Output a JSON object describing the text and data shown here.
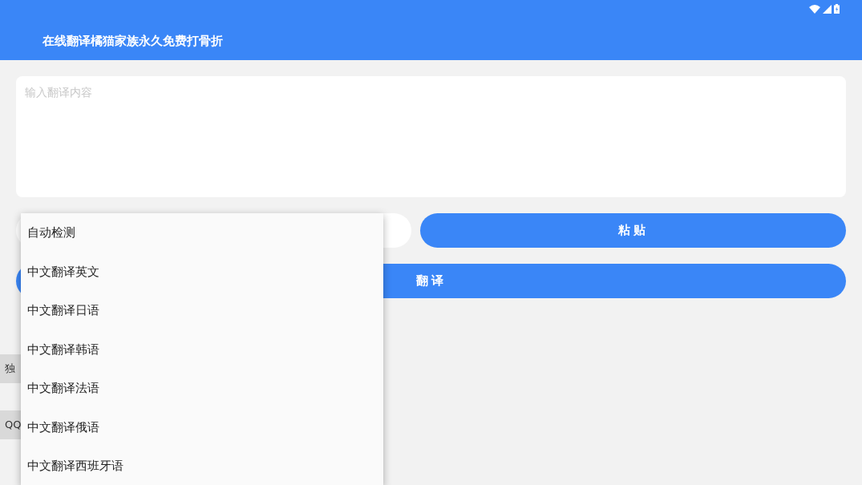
{
  "app_bar": {
    "title": "在线翻译橘猫家族永久免费打骨折"
  },
  "input": {
    "placeholder": "输入翻译内容"
  },
  "paste_button": "粘贴",
  "translate_button": "翻译",
  "side_buttons": [
    "独",
    "QQ"
  ],
  "dropdown": {
    "expanded": true,
    "items": [
      {
        "label": "自动检测"
      },
      {
        "label": "中文翻译英文"
      },
      {
        "label": "中文翻译日语"
      },
      {
        "label": "中文翻译韩语"
      },
      {
        "label": "中文翻译法语"
      },
      {
        "label": "中文翻译俄语"
      },
      {
        "label": "中文翻译西班牙语"
      }
    ]
  }
}
